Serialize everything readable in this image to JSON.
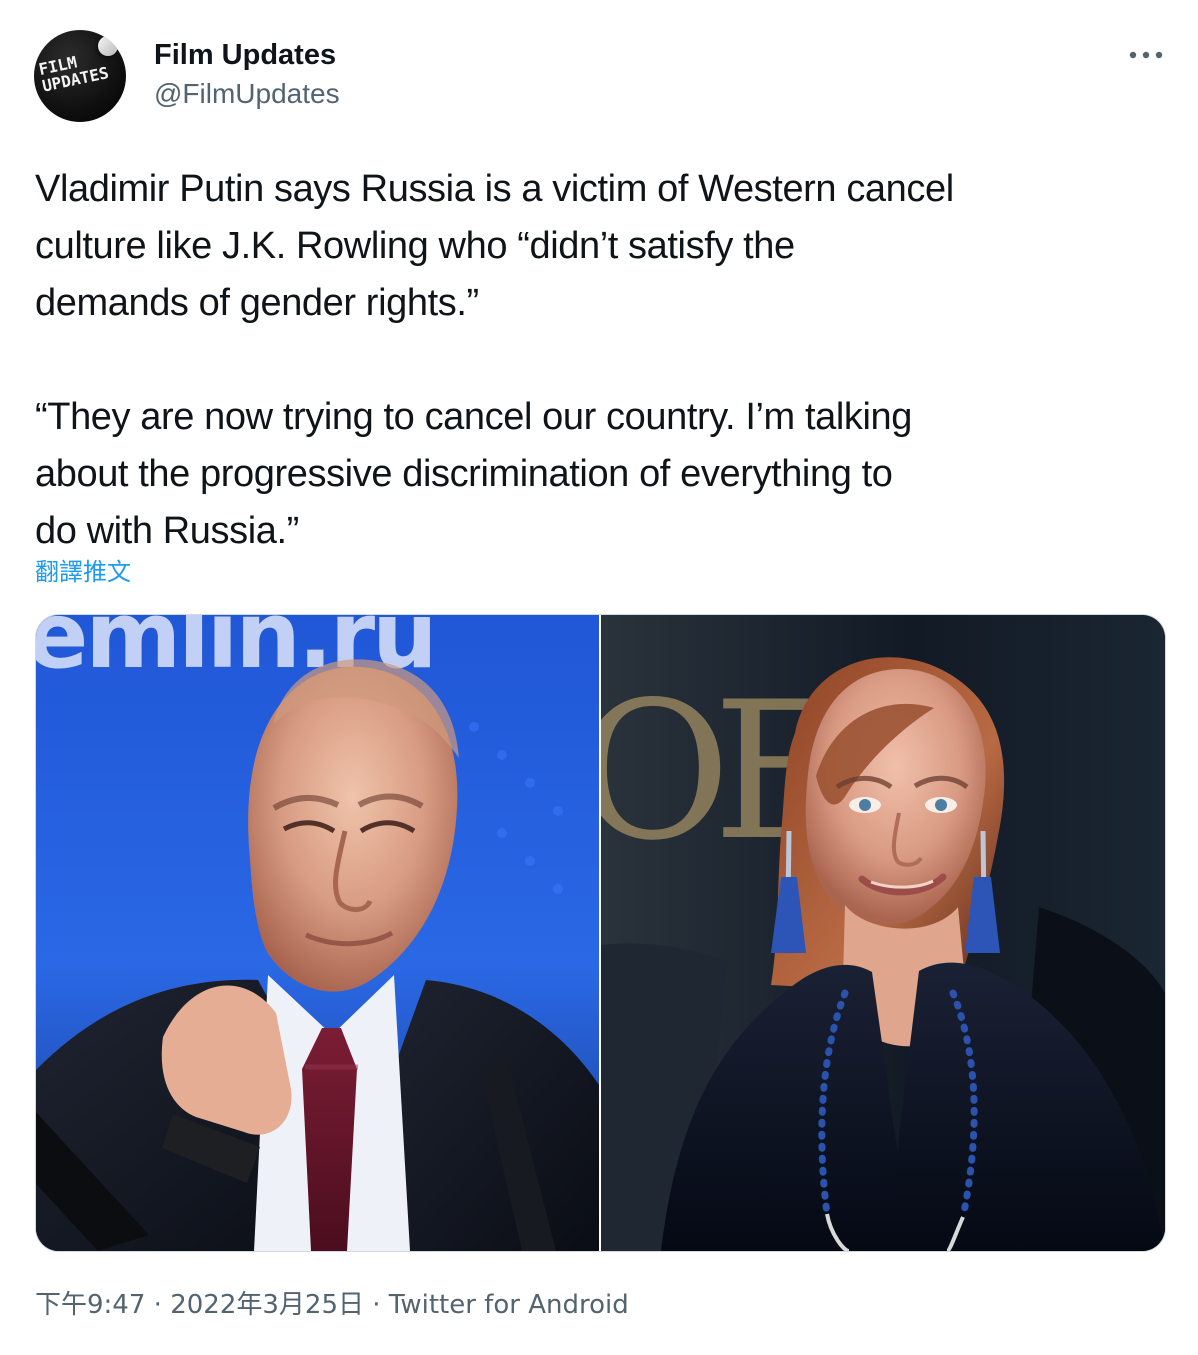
{
  "tweet": {
    "avatar": {
      "line1": "Film",
      "line2": "Updates"
    },
    "author": {
      "display_name": "Film Updates",
      "handle": "@FilmUpdates"
    },
    "menu_icon": "more-horizontal-icon",
    "body": "Vladimir Putin says Russia is a victim of Western cancel\nculture like J.K. Rowling who “didn’t satisfy the\ndemands of gender rights.”\n\n“They are now trying to cancel our country. I’m talking\nabout the progressive discrimination of everything to\ndo with Russia.”",
    "translate_label": "翻譯推文",
    "photos": {
      "left_backdrop_text": "emlin.ru",
      "right_backdrop_text": "OF"
    },
    "meta": {
      "time": "下午9:47",
      "separator": "·",
      "date": "2022年3月25日",
      "client": "Twitter for Android"
    }
  },
  "colors": {
    "primary_text": "#0f1419",
    "secondary_text": "#536471",
    "link": "#1d9bf0",
    "border": "#cfd9de"
  }
}
